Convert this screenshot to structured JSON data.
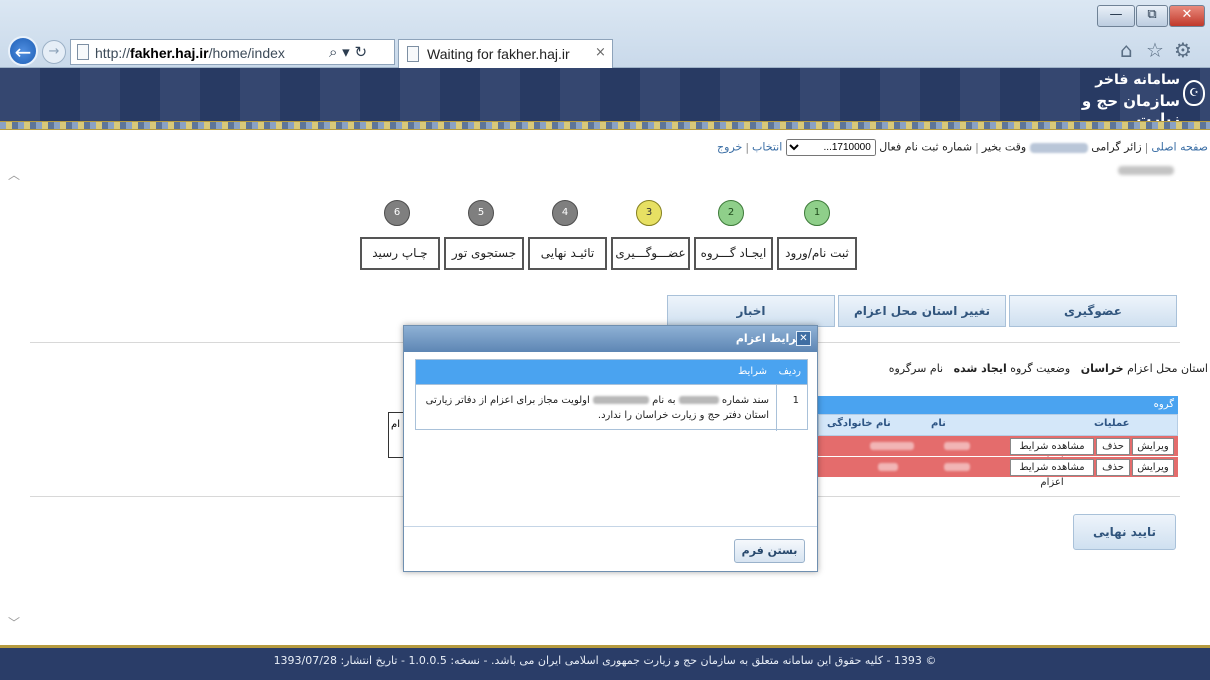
{
  "browser": {
    "url_prefix": "http://",
    "url_host": "fakher.haj.ir",
    "url_path": "/home/index",
    "tab_title": "Waiting for fakher.haj.ir",
    "tab_close": "×",
    "address_tools": "⌕ ▾ ↻",
    "back": "←",
    "forward": "→"
  },
  "window": {
    "minimize": "—",
    "restore": "⧉",
    "close": "✕"
  },
  "banner": {
    "title1": "سامانه فاخر",
    "title2": "سازمان حج و زیارت",
    "logo": "☪"
  },
  "topnav": {
    "home": "صفحه اصلی",
    "greeting_prefix": "زائر گرامی",
    "greeting_suffix": "وقت بخیر",
    "active_reg_label": "شماره ثبت نام فعال",
    "select_value": "1710000...",
    "select_label": "انتخاب",
    "logout": "خروج"
  },
  "steps": [
    {
      "num": "1",
      "label": "ثبت نام/ورود",
      "state": "done"
    },
    {
      "num": "2",
      "label": "ایجـاد گـــروه",
      "state": "done"
    },
    {
      "num": "3",
      "label": "عضـــوگـــیری",
      "state": "current"
    },
    {
      "num": "4",
      "label": "تائیـد نهایی",
      "state": "todo"
    },
    {
      "num": "5",
      "label": "جستجوی تور",
      "state": "todo"
    },
    {
      "num": "6",
      "label": "چـاپ رسید",
      "state": "todo"
    }
  ],
  "panel_tabs": {
    "membership": "عضوگیری",
    "change_province": "تغییر استان محل اعزام",
    "news": "اخبار"
  },
  "info_line": {
    "province_label": "استان محل اعزام",
    "province_value": "خراسان",
    "status_label": "وضعیت گروه",
    "status_value": "ایجاد شده",
    "head_label": "نام سرگروه"
  },
  "group_table": {
    "title": "گروه",
    "columns": {
      "ops": "عملیات",
      "name": "نام",
      "family": "نام خانوادگی"
    },
    "rows": [
      {
        "edit": "ویرایش",
        "delete": "حذف",
        "view": "مشاهده شرایط اعزام"
      },
      {
        "edit": "ویرایش",
        "delete": "حذف",
        "view": "مشاهده شرایط اعزام"
      }
    ],
    "left_fragment": "ام"
  },
  "final_button": "تایید نهایی",
  "footer": "© 1393 - کلیه حقوق این سامانه متعلق به سازمان حج و زیارت جمهوری اسلامی ایران می باشد. - نسخه: 1.0.0.5 - تاریخ انتشار: 1393/07/28",
  "modal": {
    "title": "شرایط اعزام",
    "close_icon": "✕",
    "col_radif": "ردیف",
    "col_condition": "شرایط",
    "row_num": "1",
    "row_text_prefix": "سند شماره",
    "row_text_mid1": "به نام",
    "row_text_mid2": "اولویت مجاز برای اعزام از دفاتر زیارتی استان دفتر حج و زیارت خراسان را ندارد.",
    "close_button": "بستن فرم"
  }
}
